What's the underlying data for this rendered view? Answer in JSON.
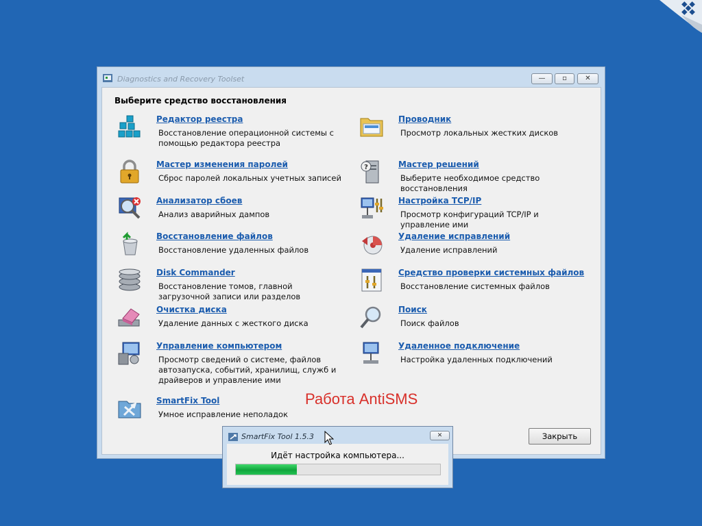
{
  "window": {
    "title": "Diagnostics and Recovery Toolset",
    "minimize_glyph": "—",
    "maximize_glyph": "▫",
    "close_glyph": "✕"
  },
  "heading": "Выберите средство восстановления",
  "tools_left": [
    {
      "link": "Редактор реестра",
      "desc": "Восстановление операционной системы с помощью редактора реестра",
      "icon": "registry-icon"
    },
    {
      "link": "Мастер изменения паролей",
      "desc": "Сброс паролей локальных учетных записей",
      "icon": "padlock-icon"
    },
    {
      "link": "Анализатор сбоев",
      "desc": "Анализ аварийных дампов",
      "icon": "crash-analyzer-icon"
    },
    {
      "link": "Восстановление файлов",
      "desc": "Восстановление удаленных файлов",
      "icon": "recycle-bin-icon"
    },
    {
      "link": "Disk Commander",
      "desc": "Восстановление томов, главной загрузочной записи или разделов",
      "icon": "disk-stack-icon"
    },
    {
      "link": "Очистка диска",
      "desc": "Удаление данных с жесткого диска",
      "icon": "eraser-icon"
    },
    {
      "link": "Управление компьютером",
      "desc": "Просмотр сведений о системе, файлов автозапуска, событий, хранилищ, служб и драйверов и управление ими",
      "icon": "computer-management-icon"
    },
    {
      "link": "SmartFix Tool",
      "desc": "Умное исправление неполадок",
      "icon": "toolbox-folder-icon"
    }
  ],
  "tools_right": [
    {
      "link": "Проводник",
      "desc": "Просмотр локальных жестких дисков",
      "icon": "explorer-folder-icon"
    },
    {
      "link": "Мастер решений",
      "desc": "Выберите необходимое средство восстановления",
      "icon": "solution-wizard-icon"
    },
    {
      "link": "Настройка TCP/IP",
      "desc": "Просмотр конфигураций TCP/IP и управление ими",
      "icon": "network-config-icon"
    },
    {
      "link": "Удаление исправлений",
      "desc": "Удаление исправлений",
      "icon": "hotfix-uninstall-icon"
    },
    {
      "link": "Средство проверки системных файлов",
      "desc": "Восстановление системных файлов",
      "icon": "sfc-icon"
    },
    {
      "link": "Поиск",
      "desc": "Поиск файлов",
      "icon": "magnifier-icon"
    },
    {
      "link": "Удаленное подключение",
      "desc": "Настройка удаленных подключений",
      "icon": "remote-connection-icon"
    }
  ],
  "close_label": "Закрыть",
  "watermark": "Работа AntiSMS",
  "dialog": {
    "title": "SmartFix Tool 1.5.3",
    "close_glyph": "✕",
    "status": "Идёт настройка компьютера...",
    "progress_percent": 30
  },
  "colors": {
    "desktop": "#2166b4",
    "link": "#1b5cae",
    "progress": "#10a53c",
    "watermark": "#d8302a"
  }
}
